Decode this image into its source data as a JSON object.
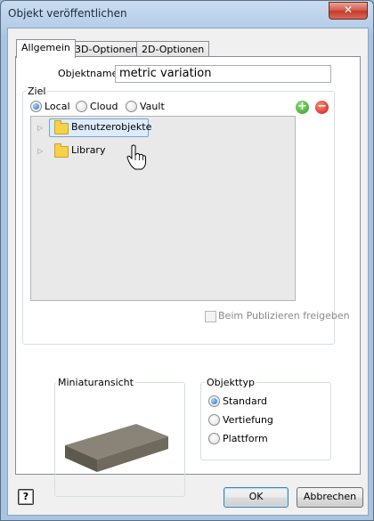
{
  "window": {
    "title": "Objekt veröffentlichen",
    "close_glyph": "✕"
  },
  "tabs": [
    {
      "label": "Allgemein"
    },
    {
      "label": "3D-Optionen"
    },
    {
      "label": "2D-Optionen"
    }
  ],
  "objektname": {
    "label": "Objektname:",
    "value": "metric variation"
  },
  "ziel": {
    "legend": "Ziel",
    "options": [
      "Local",
      "Cloud",
      "Vault"
    ],
    "selected": "Local",
    "add_glyph": "+",
    "remove_glyph": "−",
    "tree": [
      {
        "label": "Benutzerobjekte",
        "selected": true
      },
      {
        "label": "Library",
        "selected": false
      }
    ],
    "share_checkbox": {
      "label": "Beim Publizieren freigeben",
      "checked": false,
      "enabled": false
    }
  },
  "preview": {
    "legend": "Miniaturansicht"
  },
  "objekttyp": {
    "legend": "Objekttyp",
    "options": [
      "Standard",
      "Vertiefung",
      "Plattform"
    ],
    "selected": "Standard"
  },
  "buttons": {
    "help": "?",
    "ok": "OK",
    "cancel": "Abbrechen"
  }
}
